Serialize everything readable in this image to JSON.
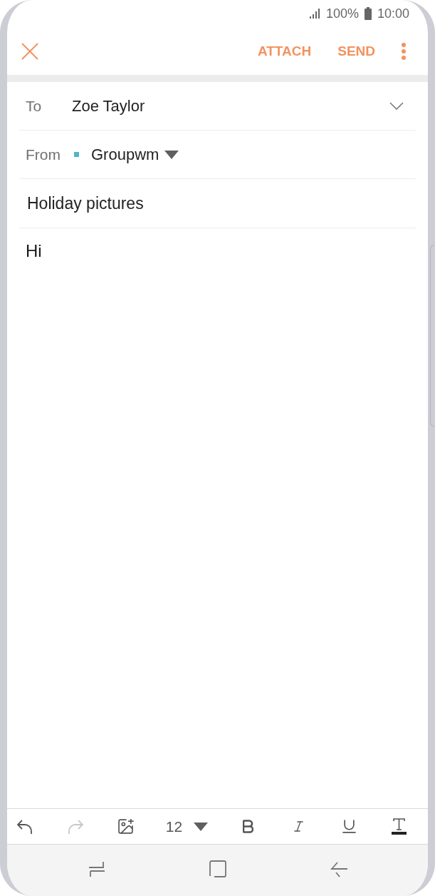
{
  "status_bar": {
    "battery": "100%",
    "time": "10:00"
  },
  "app_bar": {
    "actions": [
      {
        "label": "ATTACH"
      },
      {
        "label": "SEND"
      }
    ]
  },
  "fields": [
    {
      "kind": "recipient",
      "label": "To",
      "value": "Zoe Taylor"
    },
    {
      "kind": "sender",
      "label": "From",
      "value": "Groupwm",
      "color": "#4fb6c6"
    },
    {
      "kind": "subject",
      "value": "Holiday pictures"
    }
  ],
  "body": {
    "value": "Hi"
  },
  "format_toolbar": {
    "tools": [
      {
        "kind": "undo",
        "disabled": false
      },
      {
        "kind": "redo",
        "disabled": true
      },
      {
        "kind": "image",
        "disabled": false
      },
      {
        "kind": "font_size",
        "value": "12",
        "disabled": false
      },
      {
        "kind": "bold",
        "disabled": false
      },
      {
        "kind": "italic",
        "disabled": false
      },
      {
        "kind": "underline",
        "disabled": false
      },
      {
        "kind": "text_color",
        "disabled": false
      }
    ]
  }
}
